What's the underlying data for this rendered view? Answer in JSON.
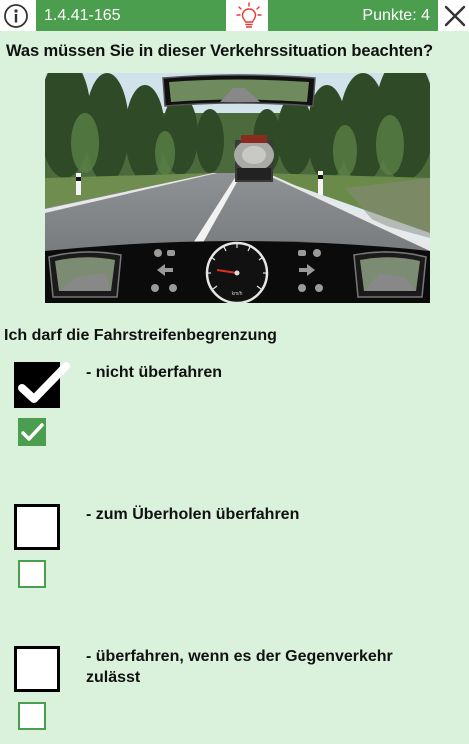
{
  "header": {
    "question_id": "1.4.41-165",
    "score_label": "Punkte: 4"
  },
  "question": {
    "text": "Was müssen Sie in dieser Verkehrssituation beachten?",
    "stem": "Ich darf die Fahrstreifenbegrenzung"
  },
  "dashboard": {
    "speed_unit": "km/h",
    "speed_ticks": [
      "20",
      "40",
      "60",
      "80",
      "100",
      "120",
      "140"
    ]
  },
  "answers": [
    {
      "text": "- nicht überfahren",
      "selected": true,
      "correct": true
    },
    {
      "text": "- zum Überholen überfahren",
      "selected": false,
      "correct": false
    },
    {
      "text": "- überfahren, wenn es der Gegenverkehr zulässt",
      "selected": false,
      "correct": false
    }
  ],
  "colors": {
    "accent_green": "#4a9e4e",
    "background": "#daf2dc",
    "hint_red": "#e53935"
  },
  "icons": [
    "info-icon",
    "lightbulb-icon",
    "close-icon",
    "checkmark-icon"
  ]
}
